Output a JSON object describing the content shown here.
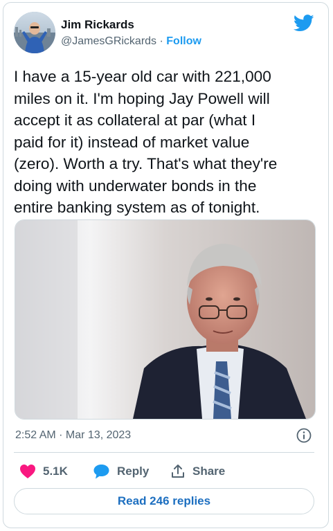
{
  "author": {
    "name": "Jim Rickards",
    "handle": "@JamesGRickards",
    "separator": " · ",
    "follow_label": "Follow"
  },
  "tweet": {
    "text": "I have a 15-year old car with 221,000\nmiles on it. I'm hoping Jay Powell will\naccept it as collateral at par (what I\npaid for it) instead of market value\n(zero). Worth a try. That's what they're\ndoing with underwater bonds in the\nentire banking system as of tonight.",
    "time": "2:52 AM",
    "date_separator": " · ",
    "date": "Mar 13, 2023"
  },
  "actions": {
    "like_count": "5.1K",
    "reply_label": "Reply",
    "share_label": "Share",
    "read_replies_label": "Read 246 replies"
  },
  "icons": {
    "brand": "twitter-bird-icon",
    "like": "heart-icon",
    "reply": "speech-bubble-icon",
    "share": "share-upload-icon",
    "info": "info-icon"
  },
  "colors": {
    "twitter_blue": "#1d9bf0",
    "like_pink": "#f91880",
    "muted_text": "#536471",
    "border": "#cfd9de",
    "link_blue": "#1d6fc0"
  }
}
